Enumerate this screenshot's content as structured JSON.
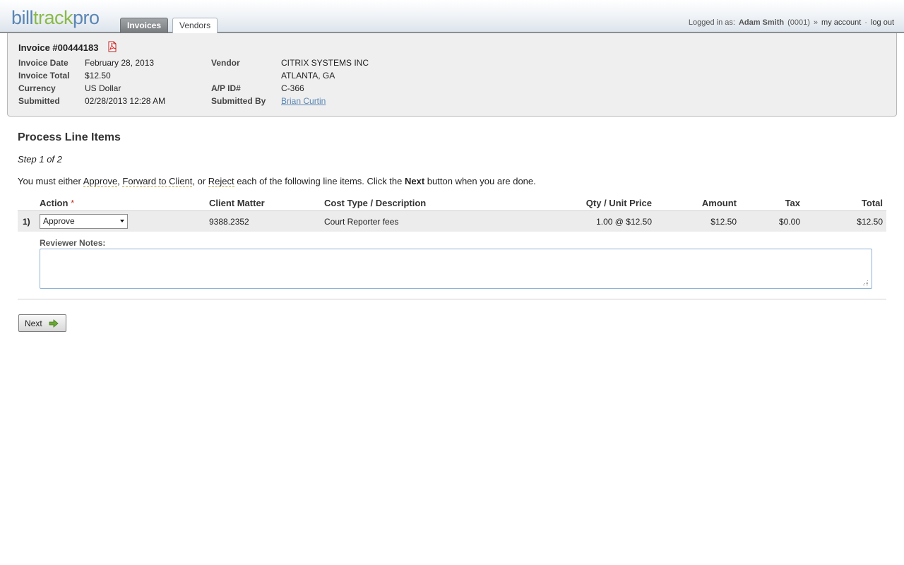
{
  "header": {
    "logo": {
      "part1": "bill",
      "part2": "track",
      "part3": "pro"
    },
    "tabs": [
      {
        "label": "Invoices",
        "active": true
      },
      {
        "label": "Vendors",
        "active": false
      }
    ],
    "user": {
      "prefix": "Logged in as:",
      "name": "Adam Smith",
      "id": "(0001)",
      "sep1": "»",
      "my_account": "my account",
      "sep2": "·",
      "logout": "log out"
    }
  },
  "invoice": {
    "title": "Invoice #00444183",
    "pdf_icon": "pdf-icon",
    "fields": {
      "invoice_date_label": "Invoice Date",
      "invoice_date": "February 28, 2013",
      "invoice_total_label": "Invoice Total",
      "invoice_total": "$12.50",
      "currency_label": "Currency",
      "currency": "US Dollar",
      "submitted_label": "Submitted",
      "submitted": "02/28/2013 12:28 AM",
      "vendor_label": "Vendor",
      "vendor_name": "CITRIX SYSTEMS INC",
      "vendor_location": "ATLANTA, GA",
      "ap_id_label": "A/P ID#",
      "ap_id": "C-366",
      "submitted_by_label": "Submitted By",
      "submitted_by": "Brian Curtin"
    }
  },
  "main": {
    "title": "Process Line Items",
    "step": "Step 1 of 2",
    "instructions": {
      "t1": "You must either ",
      "approve": "Approve",
      "t2": ", ",
      "forward": "Forward to Client",
      "t3": ", or ",
      "reject": "Reject",
      "t4": " each of the following line items. Click the ",
      "next": "Next",
      "t5": " button when you are done."
    },
    "table": {
      "headers": {
        "action": "Action",
        "required_mark": "*",
        "client_matter": "Client Matter",
        "cost_type": "Cost Type / Description",
        "qty_unit": "Qty / Unit Price",
        "amount": "Amount",
        "tax": "Tax",
        "total": "Total"
      },
      "rows": [
        {
          "num": "1)",
          "action": "Approve",
          "client_matter": "9388.2352",
          "cost_type": "Court Reporter fees",
          "qty_unit": "1.00 @ $12.50",
          "amount": "$12.50",
          "tax": "$0.00",
          "total": "$12.50"
        }
      ]
    },
    "reviewer_notes_label": "Reviewer Notes:",
    "reviewer_notes_value": "",
    "next_button": "Next"
  },
  "colors": {
    "brand_blue": "#5b86b4",
    "brand_green": "#8ab94a",
    "required": "#c0392b"
  }
}
